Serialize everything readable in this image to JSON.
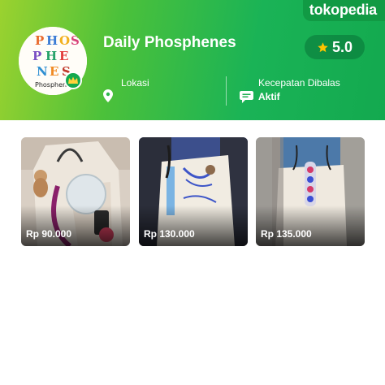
{
  "brand": {
    "name": "tokopedia"
  },
  "store": {
    "logo_letters": [
      "P",
      "H",
      "O",
      "S",
      "P",
      "H",
      "E",
      "N",
      "E",
      "S"
    ],
    "logo_caption": "Phosphenes",
    "name": "Daily Phosphenes",
    "rating": "5.0",
    "location_label": "Lokasi",
    "response_label": "Kecepatan Dibalas",
    "response_value": "Aktif"
  },
  "icons": {
    "badge": "crown-icon",
    "rating": "star-icon",
    "location": "location-pin-icon",
    "response": "chat-bubble-icon"
  },
  "colors": {
    "header_gradient_start": "#9bd22f",
    "header_gradient_end": "#13a94f",
    "brand_bg": "#119a44",
    "star": "#ffc400"
  },
  "products": [
    {
      "price": "Rp 90.000"
    },
    {
      "price": "Rp 130.000"
    },
    {
      "price": "Rp 135.000"
    }
  ]
}
